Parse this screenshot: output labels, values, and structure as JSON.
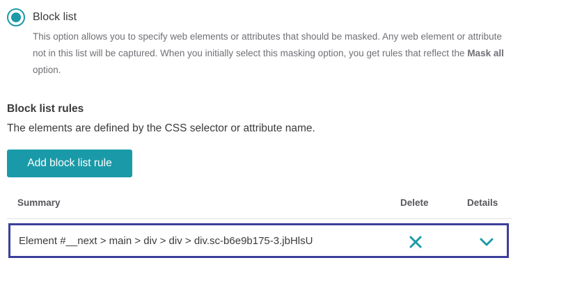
{
  "masking_option": {
    "label": "Block list",
    "selected": true,
    "description_part1": "This option allows you to specify web elements or attributes that should be masked. Any web element or attribute not in this list will be captured. When you initially select this masking option, you get rules that reflect the ",
    "description_bold": "Mask all",
    "description_part2": " option."
  },
  "rules": {
    "title": "Block list rules",
    "subtitle": "The elements are defined by the CSS selector or attribute name.",
    "add_button_label": "Add block list rule"
  },
  "table": {
    "columns": {
      "summary": "Summary",
      "delete": "Delete",
      "details": "Details"
    },
    "rows": [
      {
        "summary": "Element #__next > main > div > div > div.sc-b6e9b175-3.jbHlsU"
      }
    ]
  },
  "icons": {
    "delete": "close-icon",
    "details": "chevron-down-icon"
  },
  "colors": {
    "accent": "#1a9aa8",
    "row_highlight_border": "#3c3f9a",
    "text": "#3a3a3c",
    "muted_text": "#6f7075"
  }
}
